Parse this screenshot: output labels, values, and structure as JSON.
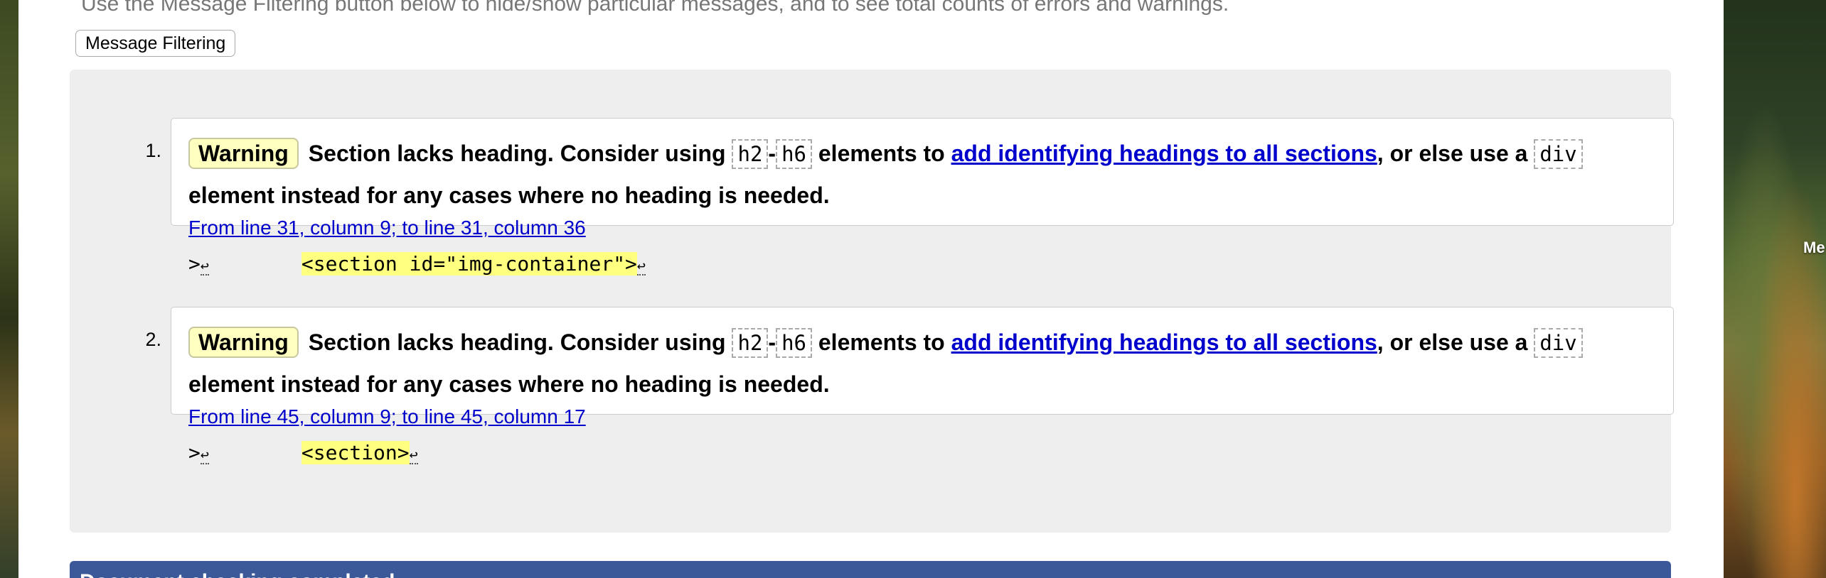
{
  "desktop": {
    "right_label": "Me"
  },
  "page": {
    "intro_text": "Use the Message Filtering button below to hide/show particular messages, and to see total counts of errors and warnings.",
    "filter_button_label": "Message Filtering",
    "messages": [
      {
        "number": "1.",
        "badge": "Warning",
        "text_before": "Section lacks heading. Consider using",
        "code_h2": "h2",
        "dash": "-",
        "code_h6": "h6",
        "text_mid": "elements to",
        "link": "add identifying headings to all sections",
        "text_after": ", or else use a",
        "code_div": "div",
        "text_end": "element instead for any cases where no heading is needed.",
        "location": "From line 31, column 9; to line 31, column 36",
        "extract_prefix": ">",
        "ret_symbol": "↩",
        "extract_code": "<section id=\"img-container\">"
      },
      {
        "number": "2.",
        "badge": "Warning",
        "text_before": "Section lacks heading. Consider using",
        "code_h2": "h2",
        "dash": "-",
        "code_h6": "h6",
        "text_mid": "elements to",
        "link": "add identifying headings to all sections",
        "text_after": ", or else use a",
        "code_div": "div",
        "text_end": "element instead for any cases where no heading is needed.",
        "location": "From line 45, column 9; to line 45, column 17",
        "extract_prefix": ">",
        "ret_symbol": "↩",
        "extract_code": "<section>"
      }
    ],
    "bottom_bar_text": "Document checking completed."
  }
}
